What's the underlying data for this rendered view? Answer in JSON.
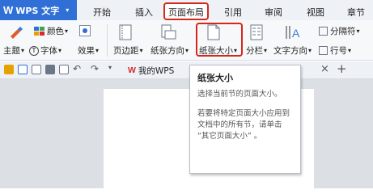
{
  "app": {
    "logo": "W",
    "name": "WPS 文字"
  },
  "tabs": [
    {
      "label": "开始"
    },
    {
      "label": "插入"
    },
    {
      "label": "页面布局"
    },
    {
      "label": "引用"
    },
    {
      "label": "审阅"
    },
    {
      "label": "视图"
    },
    {
      "label": "章节"
    }
  ],
  "ribbon": {
    "theme_label": "主题",
    "color_label": "颜色",
    "font_label": "字体",
    "effect_label": "效果",
    "margin_label": "页边距",
    "orientation_label": "纸张方向",
    "size_label": "纸张大小",
    "columns_label": "分栏",
    "text_direction_label": "文字方向",
    "separator_label": "分隔符",
    "line_number_label": "行号"
  },
  "quickbar": {
    "doc_tab_label": "我的WPS",
    "close_symbol": "×",
    "add_symbol": "+"
  },
  "tooltip": {
    "title": "纸张大小",
    "line1": "选择当前节的页面大小。",
    "line2": "若要将特定页面大小应用到文档中的所有节，请单击 “其它页面大小” 。"
  },
  "colors": {
    "accent": "#2f6fd6",
    "highlight": "#d4281c",
    "wps_red": "#d92b2b"
  }
}
